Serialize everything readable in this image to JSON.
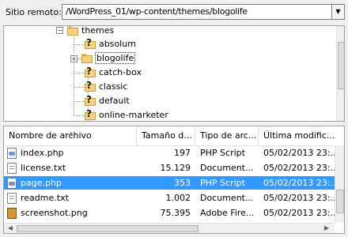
{
  "remote_path": {
    "label": "Sitio remoto:",
    "value": "/WordPress_01/wp-content/themes/blogolife"
  },
  "tree": {
    "items": [
      {
        "name": "themes",
        "icon": "folder-icon",
        "expander": "minus"
      },
      {
        "name": "absolum",
        "icon": "question-folder-icon"
      },
      {
        "name": "blogolife",
        "icon": "folder-icon",
        "expander": "plus",
        "selected": true
      },
      {
        "name": "catch-box",
        "icon": "question-folder-icon"
      },
      {
        "name": "classic",
        "icon": "question-folder-icon"
      },
      {
        "name": "default",
        "icon": "question-folder-icon"
      },
      {
        "name": "online-marketer",
        "icon": "question-folder-icon"
      }
    ]
  },
  "file_list": {
    "columns": [
      "Nombre de archivo",
      "Tamaño d...",
      "Tipo de arc...",
      "Última modific..."
    ],
    "sort_indicator": "up-arrow-icon",
    "rows": [
      {
        "name": "index.php",
        "size": "197",
        "type": "PHP Script",
        "modified": "05/02/2013 23:...",
        "icon": "php-file-icon"
      },
      {
        "name": "license.txt",
        "size": "15.129",
        "type": "Document...",
        "modified": "05/02/2013 23:...",
        "icon": "text-file-icon"
      },
      {
        "name": "page.php",
        "size": "353",
        "type": "PHP Script",
        "modified": "05/02/2013 23:...",
        "icon": "php-file-icon",
        "selected": true
      },
      {
        "name": "readme.txt",
        "size": "1.002",
        "type": "Document...",
        "modified": "05/02/2013 23:...",
        "icon": "text-file-icon"
      },
      {
        "name": "screenshot.png",
        "size": "75.395",
        "type": "Adobe Fire...",
        "modified": "05/02/2013 23:...",
        "icon": "image-file-icon"
      }
    ]
  },
  "colors": {
    "selection": "#3399ff",
    "folder": "#f4d27a"
  }
}
